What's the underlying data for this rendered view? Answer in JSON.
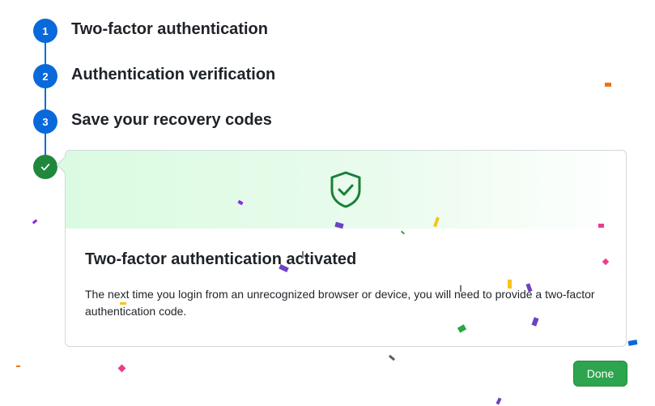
{
  "steps": [
    {
      "number": "1",
      "label": "Two-factor authentication"
    },
    {
      "number": "2",
      "label": "Authentication verification"
    },
    {
      "number": "3",
      "label": "Save your recovery codes"
    }
  ],
  "success_card": {
    "icon": "shield-check-icon",
    "title": "Two-factor authentication activated",
    "message": "The next time you login from an unrecognized browser or device, you will need to provide a two-factor authentication code."
  },
  "actions": {
    "done_label": "Done"
  },
  "colors": {
    "step_blue": "#0969da",
    "success_green": "#1f883d",
    "button_green": "#2da44e"
  }
}
